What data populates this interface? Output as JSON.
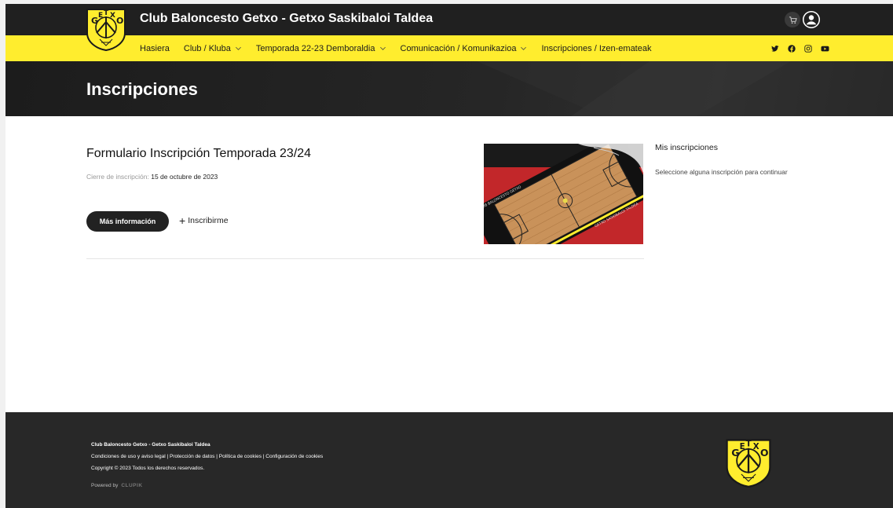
{
  "header": {
    "site_title": "Club Baloncesto Getxo - Getxo Saskibaloi Taldea",
    "logo_letters": "GETXO",
    "cart_icon": "cart-icon",
    "user_icon": "user-icon"
  },
  "nav": {
    "items": [
      {
        "label": "Hasiera",
        "has_dropdown": false
      },
      {
        "label": "Club / Kluba",
        "has_dropdown": true
      },
      {
        "label": "Temporada 22-23 Demboraldia",
        "has_dropdown": true
      },
      {
        "label": "Comunicación / Komunikazioa",
        "has_dropdown": true
      },
      {
        "label": "Inscripciones / Izen-emateak",
        "has_dropdown": false
      }
    ],
    "social": [
      "twitter-icon",
      "facebook-icon",
      "instagram-icon",
      "youtube-icon"
    ]
  },
  "hero": {
    "title": "Inscripciones"
  },
  "event": {
    "title": "Formulario Inscripción Temporada 23/24",
    "close_label": "Cierre de inscripción:",
    "close_date": "15 de octubre de 2023",
    "more_button": "Más información",
    "signup_link": "Inscribirme",
    "image_text_1": "CLUB BALONCESTO GETXO",
    "image_text_2": "GETXO SASKIBALOI TALDEA"
  },
  "sidebar": {
    "title": "Mis inscripciones",
    "text": "Seleccione alguna inscripción para continuar"
  },
  "footer": {
    "name": "Club Baloncesto Getxo - Getxo Saskibaloi Taldea",
    "links": [
      "Condiciones de uso y aviso legal",
      "Protección de datos",
      "Política de cookies",
      "Configuración de cookies"
    ],
    "copyright": "Copyright © 2023 Todos los derechos reservados.",
    "powered_by": "Powered by",
    "powered_brand": "CLUPIK"
  },
  "colors": {
    "brand_yellow": "#ffed2e",
    "dark": "#202020",
    "footer": "#282828"
  }
}
